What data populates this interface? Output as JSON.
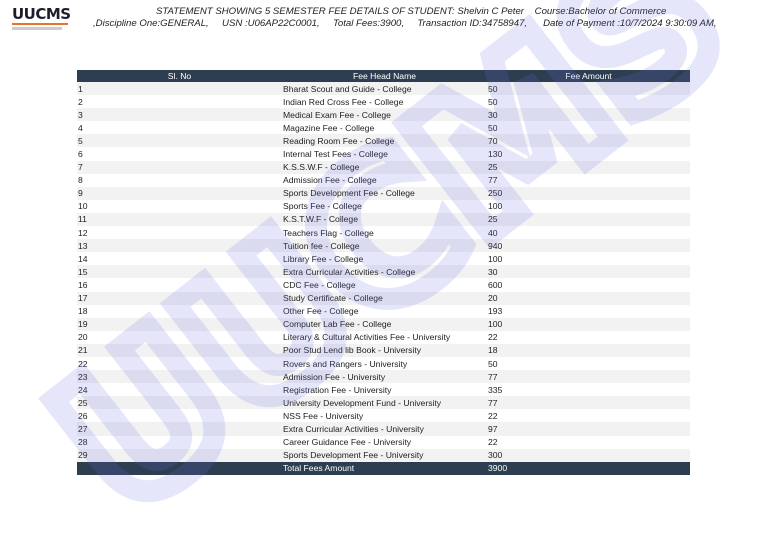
{
  "logo": {
    "text": "UUCMS",
    "accent": "#e8742c"
  },
  "header": {
    "line1": "STATEMENT SHOWING 5 SEMESTER FEE DETAILS OF STUDENT: Shelvin C Peter    Course:Bachelor of Commerce",
    "line2": ",Discipline One:GENERAL,     USN :U06AP22C0001,     Total Fees:3900,     Transaction ID:34758947,      Date of Payment :10/7/2024 9:30:09 AM,"
  },
  "table": {
    "columns": [
      "Sl. No",
      "Fee Head Name",
      "Fee Amount"
    ],
    "rows": [
      [
        "1",
        "Bharat Scout and Guide - College",
        "50"
      ],
      [
        "2",
        "Indian Red Cross Fee - College",
        "50"
      ],
      [
        "3",
        "Medical Exam Fee - College",
        "30"
      ],
      [
        "4",
        "Magazine Fee - College",
        "50"
      ],
      [
        "5",
        "Reading Room Fee - College",
        "70"
      ],
      [
        "6",
        "Internal Test Fees - College",
        "130"
      ],
      [
        "7",
        "K.S.S.W.F - College",
        "25"
      ],
      [
        "8",
        "Admission Fee - College",
        "77"
      ],
      [
        "9",
        "Sports Development Fee - College",
        "250"
      ],
      [
        "10",
        "Sports Fee - College",
        "100"
      ],
      [
        "11",
        "K.S.T.W.F - College",
        "25"
      ],
      [
        "12",
        "Teachers Flag - College",
        "40"
      ],
      [
        "13",
        "Tuition fee - College",
        "940"
      ],
      [
        "14",
        "Library Fee - College",
        "100"
      ],
      [
        "15",
        "Extra Curricular Activities - College",
        "30"
      ],
      [
        "16",
        "CDC Fee - College",
        "600"
      ],
      [
        "17",
        "Study Certificate - College",
        "20"
      ],
      [
        "18",
        "Other Fee - College",
        "193"
      ],
      [
        "19",
        "Computer Lab Fee - College",
        "100"
      ],
      [
        "20",
        "Literary & Cultural Activities Fee - University",
        "22"
      ],
      [
        "21",
        "Poor Stud Lend lib Book - University",
        "18"
      ],
      [
        "22",
        "Rovers and Rangers - University",
        "50"
      ],
      [
        "23",
        "Admission Fee - University",
        "77"
      ],
      [
        "24",
        "Registration Fee - University",
        "335"
      ],
      [
        "25",
        "University Development Fund - University",
        "77"
      ],
      [
        "26",
        "NSS Fee - University",
        "22"
      ],
      [
        "27",
        "Extra Curricular Activities - University",
        "97"
      ],
      [
        "28",
        "Career Guidance Fee - University",
        "22"
      ],
      [
        "29",
        "Sports Development Fee - University",
        "300"
      ]
    ],
    "total_label": "Total Fees Amount",
    "total_value": "3900"
  },
  "watermark": {
    "text": "UUCMS",
    "color": "#6a6ae6"
  },
  "colors": {
    "header_bg": "#2c3e50"
  }
}
